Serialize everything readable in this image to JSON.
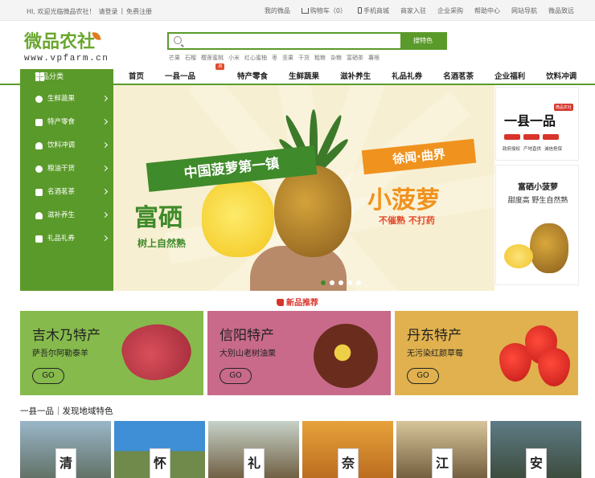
{
  "topbar": {
    "greeting": "HI, 欢迎光临微品农社！",
    "login": "请登录",
    "sep": "|",
    "register": "免费注册",
    "links": [
      "我的微品",
      "购物车（0）",
      "手机商城",
      "商家入驻",
      "企业采购",
      "帮助中心",
      "网站导航",
      "微品致远"
    ]
  },
  "logo": {
    "name": "微品农社",
    "url": "www.vpfarm.cn"
  },
  "search": {
    "placeholder": "",
    "button": "搜特色",
    "hotwords": [
      "芒果",
      "石榴",
      "樱莲蜜桃",
      "小米",
      "红心蜜柚",
      "枣",
      "坚果",
      "干货",
      "粗粮",
      "杂粮",
      "富硒茶",
      "薯根"
    ]
  },
  "nav": {
    "category_label": "商品分类",
    "items": [
      "首页",
      "一县一品",
      "特产零食",
      "生鲜蔬果",
      "滋补养生",
      "礼品礼券",
      "名酒茗茶",
      "企业福利",
      "饮料冲调"
    ],
    "hot_badge": "热"
  },
  "sidebar": {
    "items": [
      "生鲜蔬果",
      "特产零食",
      "饮料冲调",
      "粮油干货",
      "名酒茗茶",
      "滋补养生",
      "礼品礼券"
    ]
  },
  "banner": {
    "ribbon_green": "中国菠萝第一镇",
    "ribbon_orange": "徐闻·曲界",
    "big_left": "富硒",
    "sub_left": "树上自然熟",
    "big_right": "小菠萝",
    "sub_right": "不催熟  不打药",
    "slide_count": 5,
    "active_slide": 1
  },
  "right_cards": {
    "card1": {
      "title": "一县一品",
      "brand": "微品农社",
      "footer": [
        "政府授权",
        "产地直供",
        "诚信担保"
      ]
    },
    "card2": {
      "title": "富硒小菠萝",
      "subtitle": "甜度高 野生自然熟"
    }
  },
  "new_products": {
    "heading": "新品推荐",
    "cards": [
      {
        "title": "吉木乃特产",
        "subtitle": "萨吾尔阿勒泰羊",
        "cta": "GO",
        "color": "#86ba4c"
      },
      {
        "title": "信阳特产",
        "subtitle": "大别山老树油栗",
        "cta": "GO",
        "color": "#c96a8b"
      },
      {
        "title": "丹东特产",
        "subtitle": "无污染红颜草莓",
        "cta": "GO",
        "color": "#e0b14e"
      }
    ]
  },
  "region_section": {
    "title": "一县一品｜发现地域特色",
    "photos": [
      "清",
      "怀",
      "礼",
      "奈",
      "江",
      "安"
    ]
  },
  "colors": {
    "brand_green": "#5a9a2a",
    "accent_orange": "#f0921e",
    "hot_red": "#d8342a"
  }
}
